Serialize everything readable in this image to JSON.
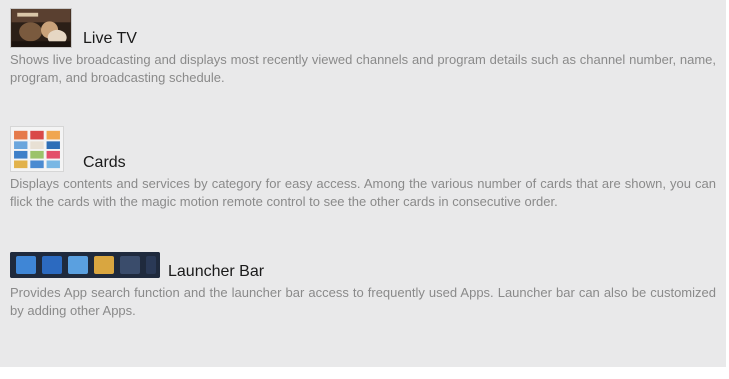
{
  "sections": [
    {
      "title": "Live TV",
      "icon": "live-tv-thumbnail-icon",
      "description": "Shows live broadcasting and displays most recently viewed channels and program details such as channel number, name, program, and broadcasting schedule."
    },
    {
      "title": "Cards",
      "icon": "cards-thumbnail-icon",
      "description": "Displays contents and services by category for easy access. Among the various number of cards that are shown, you can flick the cards with the magic motion remote control to see the other cards in consecutive order."
    },
    {
      "title": "Launcher Bar",
      "icon": "launcher-bar-thumbnail-icon",
      "description": "Provides App search function and the launcher bar access to frequently used Apps. Launcher bar can also be customized by adding other Apps."
    }
  ],
  "colors": {
    "background": "#e9e9ea",
    "title_text": "#1a1a1a",
    "body_text": "#8a8a8a"
  }
}
